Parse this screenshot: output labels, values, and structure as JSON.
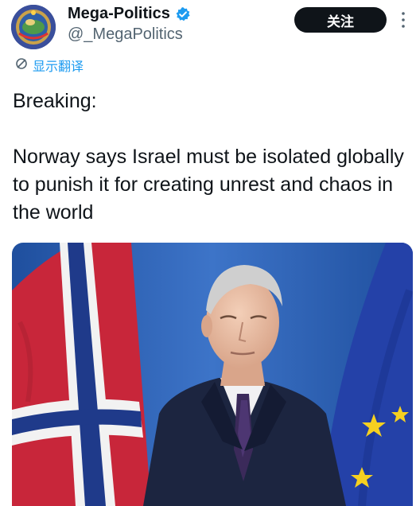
{
  "author": {
    "display_name": "Mega-Politics",
    "handle": "@_MegaPolitics",
    "avatar_icon": "globe-emblem-avatar",
    "verified_icon": "verified-badge-icon",
    "verified_color": "#1d9bf0"
  },
  "actions": {
    "follow_label": "关注",
    "more_icon": "more-vertical-icon"
  },
  "translate": {
    "label": "显示翻译",
    "icon": "translate-icon"
  },
  "tweet": {
    "text": "Breaking:\n\nNorway says Israel must be isolated globally to punish it for creating unrest and chaos in the world"
  },
  "media": {
    "icon": "photo-politician-with-flags"
  }
}
